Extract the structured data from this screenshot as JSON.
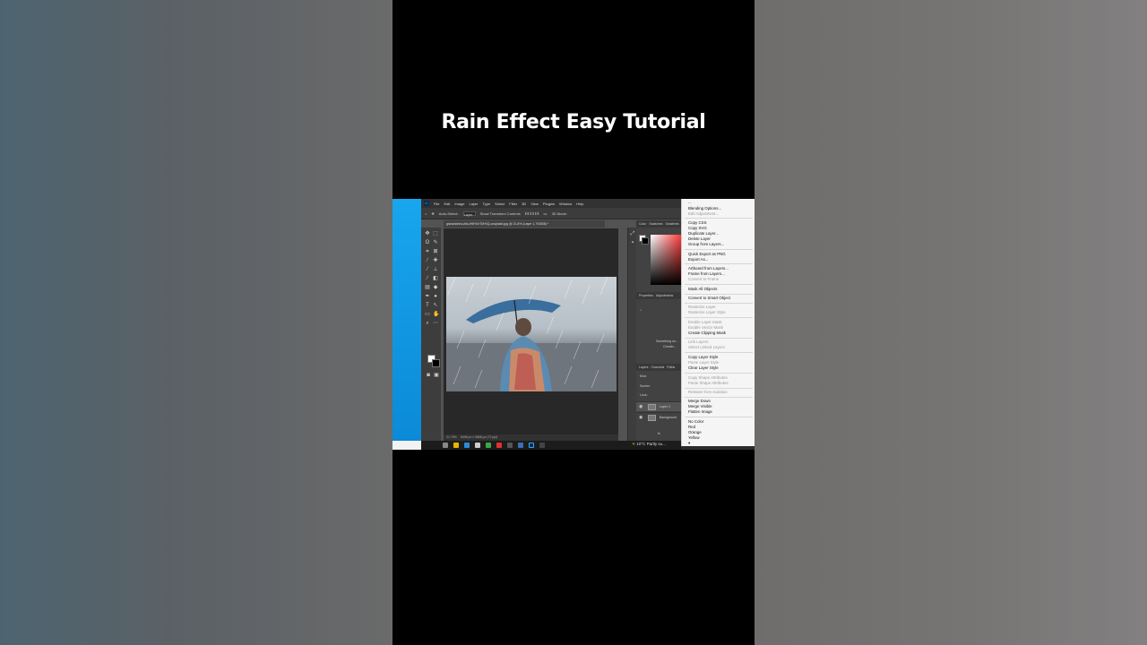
{
  "video": {
    "title": "Rain Effect Easy Tutorial"
  },
  "photoshop": {
    "menu": [
      "Ps",
      "File",
      "Edit",
      "Image",
      "Layer",
      "Type",
      "Select",
      "Filter",
      "3D",
      "View",
      "Plugins",
      "Window",
      "Help"
    ],
    "options": {
      "auto_select": "Auto-Select:",
      "target": "Layer",
      "transform": "Show Transform Controls",
      "mode": "3D Mode:"
    },
    "doc_tab": "gianandrea-villa-H9HXeTMYtQ-unsplash.jpg @ 21.8% (Layer 1, RGB/8) *",
    "status": {
      "zoom": "21.79%",
      "size": "5498 px x 3668 px (72 ppi)"
    },
    "panels": {
      "color_tabs": [
        "Color",
        "Swatches",
        "Gradients"
      ],
      "prop_tabs": [
        "Properties",
        "Adjustments"
      ],
      "prop_text_1": "Something wr...",
      "prop_text_2": "Creatin...",
      "layers_tabs": [
        "Layers",
        "Channels",
        "Paths"
      ],
      "kind": "Kind",
      "blend": "Screen",
      "lock": "Lock:",
      "layers": [
        "Layer 1",
        "Background"
      ],
      "fx_label": "fx"
    }
  },
  "taskbar": {
    "weather": "10°C  Partly su..."
  },
  "context_menu": {
    "top_item": "...",
    "items": [
      {
        "label": "Blending Options...",
        "disabled": false
      },
      {
        "label": "Edit Adjustment...",
        "disabled": true
      },
      {
        "label": "Copy CSS",
        "disabled": false
      },
      {
        "label": "Copy SVG",
        "disabled": false
      },
      {
        "label": "Duplicate Layer...",
        "disabled": false
      },
      {
        "label": "Delete Layer",
        "disabled": false
      },
      {
        "label": "Group from Layers...",
        "disabled": false
      },
      {
        "label": "Quick Export as PNG",
        "disabled": false
      },
      {
        "label": "Export As...",
        "disabled": false
      },
      {
        "label": "Artboard from Layers...",
        "disabled": false
      },
      {
        "label": "Frame from Layers...",
        "disabled": false
      },
      {
        "label": "Convert to Frame",
        "disabled": true
      },
      {
        "label": "Mask All Objects",
        "disabled": false
      },
      {
        "label": "Convert to Smart Object",
        "disabled": false
      },
      {
        "label": "Rasterize Layer",
        "disabled": true
      },
      {
        "label": "Rasterize Layer Style",
        "disabled": true
      },
      {
        "label": "Enable Layer Mask",
        "disabled": true
      },
      {
        "label": "Enable Vector Mask",
        "disabled": true
      },
      {
        "label": "Create Clipping Mask",
        "disabled": false
      },
      {
        "label": "Link Layers",
        "disabled": true
      },
      {
        "label": "Select Linked Layers",
        "disabled": true
      },
      {
        "label": "Copy Layer Style",
        "disabled": false
      },
      {
        "label": "Paste Layer Style",
        "disabled": true
      },
      {
        "label": "Clear Layer Style",
        "disabled": false
      },
      {
        "label": "Copy Shape Attributes",
        "disabled": true
      },
      {
        "label": "Paste Shape Attributes",
        "disabled": true
      },
      {
        "label": "Release from Isolation",
        "disabled": true
      },
      {
        "label": "Merge Down",
        "disabled": false
      },
      {
        "label": "Merge Visible",
        "disabled": false
      },
      {
        "label": "Flatten Image",
        "disabled": false
      },
      {
        "label": "No Color",
        "disabled": false
      },
      {
        "label": "Red",
        "disabled": false
      },
      {
        "label": "Orange",
        "disabled": false
      },
      {
        "label": "Yellow",
        "disabled": false
      }
    ]
  },
  "colors": {
    "desktop_blue": "#0b8ad8",
    "ps_dark": "#535353",
    "menu_bg": "#f5f5f5",
    "umbrella": "#3a6e9c"
  }
}
